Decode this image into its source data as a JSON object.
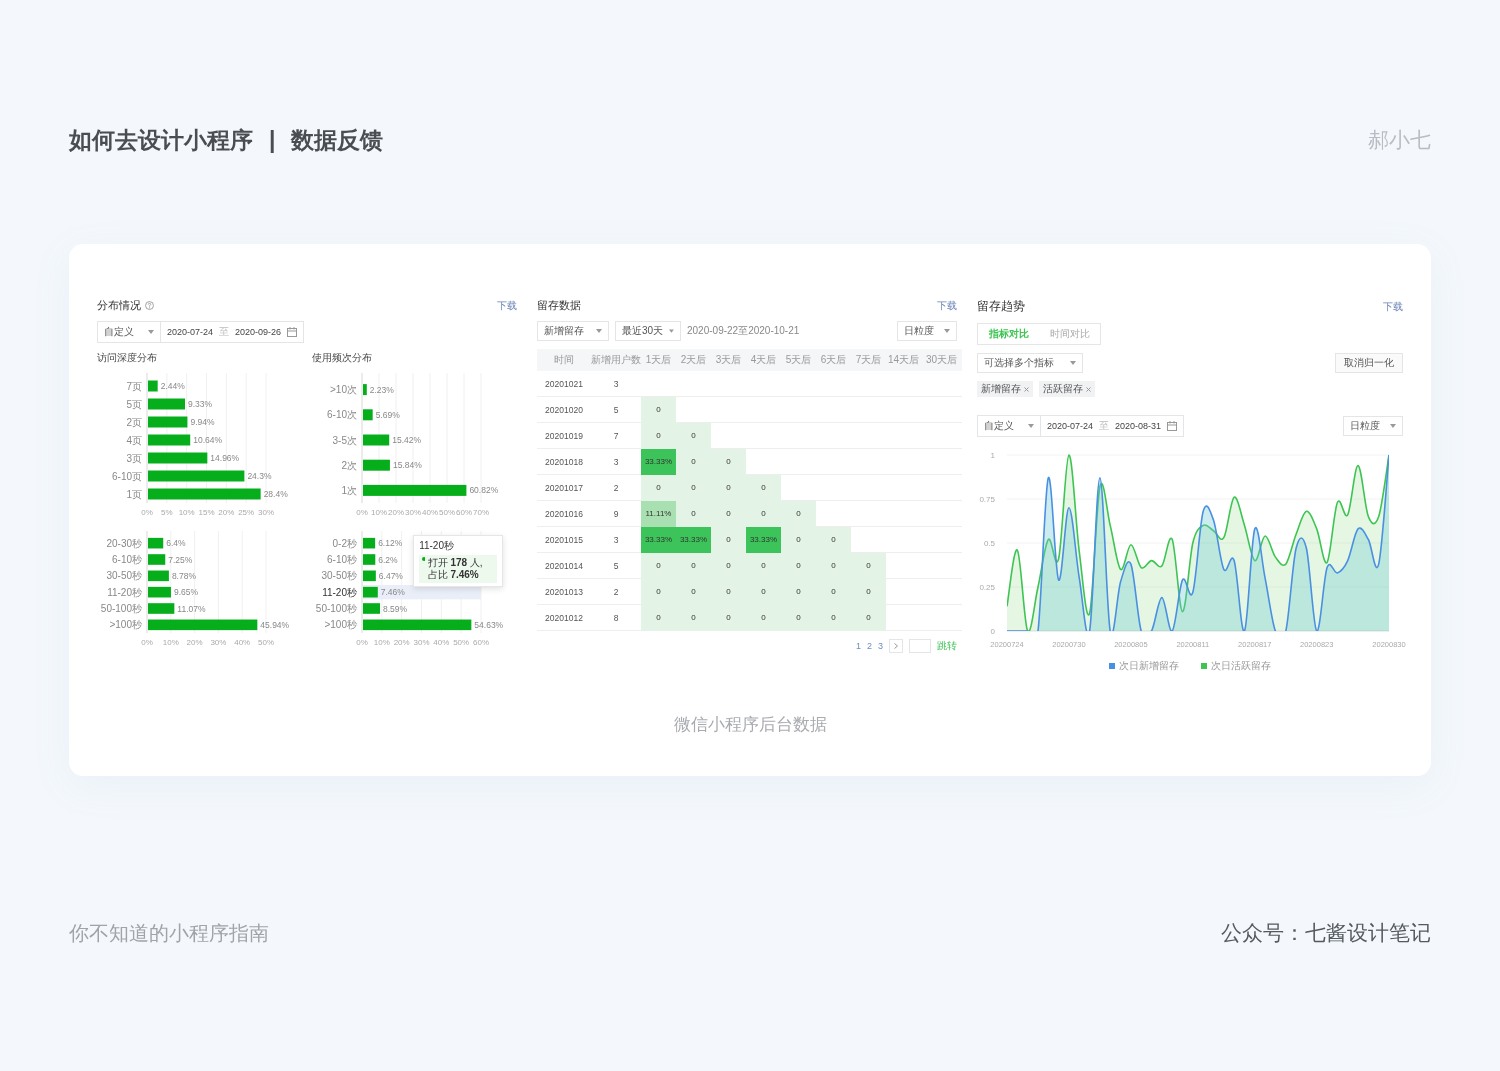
{
  "header": {
    "title": "如何去设计小程序",
    "separator": "|",
    "subtitle": "数据反馈",
    "author": "郝小七"
  },
  "distribution": {
    "title": "分布情况",
    "download": "下载",
    "date_range": {
      "preset": "自定义",
      "start": "2020-07-24",
      "separator": "至",
      "end": "2020-09-26"
    },
    "charts": [
      {
        "subtitle": "访问深度分布",
        "chart_data": {
          "type": "bar",
          "orientation": "horizontal",
          "grid": true,
          "categories": [
            "7页",
            "5页",
            "2页",
            "4页",
            "3页",
            "6-10页",
            "1页"
          ],
          "values": [
            2.44,
            9.33,
            9.94,
            10.64,
            14.96,
            24.3,
            28.4
          ],
          "value_labels": [
            "2.44%",
            "9.33%",
            "9.94%",
            "10.64%",
            "14.96%",
            "24.3%",
            "28.4%"
          ],
          "xlim": [
            0,
            30
          ],
          "xticks": [
            {
              "value": 0,
              "label": "0%"
            },
            {
              "value": 5,
              "label": "5%"
            },
            {
              "value": 10,
              "label": "10%"
            },
            {
              "value": 15,
              "label": "15%"
            },
            {
              "value": 20,
              "label": "20%"
            },
            {
              "value": 25,
              "label": "25%"
            },
            {
              "value": 30,
              "label": "30%"
            }
          ]
        }
      },
      {
        "subtitle": "使用频次分布",
        "chart_data": {
          "type": "bar",
          "orientation": "horizontal",
          "grid": true,
          "categories": [
            ">10次",
            "6-10次",
            "3-5次",
            "2次",
            "1次"
          ],
          "values": [
            2.23,
            5.69,
            15.42,
            15.84,
            60.82
          ],
          "value_labels": [
            "2.23%",
            "5.69%",
            "15.42%",
            "15.84%",
            "60.82%"
          ],
          "xlim": [
            0,
            70
          ],
          "xticks": [
            {
              "value": 0,
              "label": "0%"
            },
            {
              "value": 10,
              "label": "10%"
            },
            {
              "value": 20,
              "label": "20%"
            },
            {
              "value": 30,
              "label": "30%"
            },
            {
              "value": 40,
              "label": "40%"
            },
            {
              "value": 50,
              "label": "50%"
            },
            {
              "value": 60,
              "label": "60%"
            },
            {
              "value": 70,
              "label": "70%"
            }
          ]
        }
      },
      {
        "chart_data": {
          "type": "bar",
          "orientation": "horizontal",
          "grid": true,
          "categories": [
            "20-30秒",
            "6-10秒",
            "30-50秒",
            "11-20秒",
            "50-100秒",
            ">100秒"
          ],
          "values": [
            6.4,
            7.25,
            8.78,
            9.65,
            11.07,
            45.94
          ],
          "value_labels": [
            "6.4%",
            "7.25%",
            "8.78%",
            "9.65%",
            "11.07%",
            "45.94%"
          ],
          "xlim": [
            0,
            50
          ],
          "xticks": [
            {
              "value": 0,
              "label": "0%"
            },
            {
              "value": 10,
              "label": "10%"
            },
            {
              "value": 20,
              "label": "20%"
            },
            {
              "value": 30,
              "label": "30%"
            },
            {
              "value": 40,
              "label": "40%"
            },
            {
              "value": 50,
              "label": "50%"
            }
          ]
        }
      },
      {
        "chart_data": {
          "type": "bar",
          "orientation": "horizontal",
          "grid": true,
          "categories": [
            "0-2秒",
            "6-10秒",
            "30-50秒",
            "11-20秒",
            "50-100秒",
            ">100秒"
          ],
          "values": [
            6.12,
            6.2,
            6.47,
            7.46,
            8.59,
            54.63
          ],
          "value_labels": [
            "6.12%",
            "6.2%",
            "6.47%",
            "7.46%",
            "8.59%",
            "54.63%"
          ],
          "xlim": [
            0,
            60
          ],
          "xticks": [
            {
              "value": 0,
              "label": "0%"
            },
            {
              "value": 10,
              "label": "10%"
            },
            {
              "value": 20,
              "label": "20%"
            },
            {
              "value": 30,
              "label": "30%"
            },
            {
              "value": 40,
              "label": "40%"
            },
            {
              "value": 50,
              "label": "50%"
            },
            {
              "value": 60,
              "label": "60%"
            }
          ]
        },
        "highlighted": [
          false,
          false,
          false,
          true,
          false,
          false
        ],
        "tooltip": {
          "title": "11-20秒",
          "text": "打开 **178** 人, 占比 **7.46%**"
        }
      }
    ]
  },
  "retention_table": {
    "title": "留存数据",
    "download": "下载",
    "filters": [
      "新增留存",
      "最近30天"
    ],
    "range_text": "2020-09-22至2020-10-21",
    "granularity": "日粒度",
    "columns": [
      "时间",
      "新增用户数",
      "1天后",
      "2天后",
      "3天后",
      "4天后",
      "5天后",
      "6天后",
      "7天后",
      "14天后",
      "30天后"
    ],
    "rows": [
      {
        "date": "20201021",
        "count": "3"
      },
      {
        "date": "20201020",
        "count": "5",
        "cells": [
          {
            "text": "0",
            "color": "#e3f3e5"
          }
        ]
      },
      {
        "date": "20201019",
        "count": "7",
        "cells": [
          {
            "text": "0",
            "color": "#e3f3e5"
          },
          {
            "text": "0",
            "color": "#e3f3e5"
          }
        ]
      },
      {
        "date": "20201018",
        "count": "3",
        "cells": [
          {
            "text": "33.33%",
            "color": "#3cc45a"
          },
          {
            "text": "0",
            "color": "#e3f3e5"
          },
          {
            "text": "0",
            "color": "#e3f3e5"
          }
        ]
      },
      {
        "date": "20201017",
        "count": "2",
        "cells": [
          {
            "text": "0",
            "color": "#e3f3e5"
          },
          {
            "text": "0",
            "color": "#e3f3e5"
          },
          {
            "text": "0",
            "color": "#e3f3e5"
          },
          {
            "text": "0",
            "color": "#e3f3e5"
          }
        ]
      },
      {
        "date": "20201016",
        "count": "9",
        "cells": [
          {
            "text": "11.11%",
            "color": "#a9e0b2"
          },
          {
            "text": "0",
            "color": "#e3f3e5"
          },
          {
            "text": "0",
            "color": "#e3f3e5"
          },
          {
            "text": "0",
            "color": "#e3f3e5"
          },
          {
            "text": "0",
            "color": "#e3f3e5"
          }
        ]
      },
      {
        "date": "20201015",
        "count": "3",
        "cells": [
          {
            "text": "33.33%",
            "color": "#3cc45a"
          },
          {
            "text": "33.33%",
            "color": "#3cc45a"
          },
          {
            "text": "0",
            "color": "#e3f3e5"
          },
          {
            "text": "33.33%",
            "color": "#3cc45a"
          },
          {
            "text": "0",
            "color": "#e3f3e5"
          },
          {
            "text": "0",
            "color": "#e3f3e5"
          }
        ]
      },
      {
        "date": "20201014",
        "count": "5",
        "cells": [
          {
            "text": "0",
            "color": "#e3f3e5"
          },
          {
            "text": "0",
            "color": "#e3f3e5"
          },
          {
            "text": "0",
            "color": "#e3f3e5"
          },
          {
            "text": "0",
            "color": "#e3f3e5"
          },
          {
            "text": "0",
            "color": "#e3f3e5"
          },
          {
            "text": "0",
            "color": "#e3f3e5"
          },
          {
            "text": "0",
            "color": "#e3f3e5"
          }
        ]
      },
      {
        "date": "20201013",
        "count": "2",
        "cells": [
          {
            "text": "0",
            "color": "#e3f3e5"
          },
          {
            "text": "0",
            "color": "#e3f3e5"
          },
          {
            "text": "0",
            "color": "#e3f3e5"
          },
          {
            "text": "0",
            "color": "#e3f3e5"
          },
          {
            "text": "0",
            "color": "#e3f3e5"
          },
          {
            "text": "0",
            "color": "#e3f3e5"
          },
          {
            "text": "0",
            "color": "#e3f3e5"
          }
        ]
      },
      {
        "date": "20201012",
        "count": "8",
        "cells": [
          {
            "text": "0",
            "color": "#e3f3e5"
          },
          {
            "text": "0",
            "color": "#e3f3e5"
          },
          {
            "text": "0",
            "color": "#e3f3e5"
          },
          {
            "text": "0",
            "color": "#e3f3e5"
          },
          {
            "text": "0",
            "color": "#e3f3e5"
          },
          {
            "text": "0",
            "color": "#e3f3e5"
          },
          {
            "text": "0",
            "color": "#e3f3e5"
          }
        ]
      }
    ],
    "pagination": {
      "pages": [
        "1",
        "2",
        "3"
      ],
      "jump": "跳转"
    }
  },
  "retention_trend": {
    "title": "留存趋势",
    "download": "下载",
    "tabs": [
      {
        "label": "指标对比",
        "selected": true
      },
      {
        "label": "时间对比",
        "selected": false
      }
    ],
    "metric_select": {
      "placeholder": "可选择多个指标"
    },
    "tags": [
      "新增留存",
      "活跃留存"
    ],
    "normalize_button": "取消归一化",
    "date_range": {
      "preset": "自定义",
      "start": "2020-07-24",
      "separator": "至",
      "end": "2020-08-31"
    },
    "granularity": "日粒度",
    "chart_data": {
      "type": "area",
      "grid": true,
      "legend": "bottom",
      "categories": [
        "20200724",
        null,
        null,
        null,
        null,
        null,
        "20200730",
        null,
        null,
        null,
        null,
        null,
        "20200805",
        null,
        null,
        null,
        null,
        null,
        "20200811",
        null,
        null,
        null,
        null,
        null,
        "20200817",
        null,
        null,
        null,
        null,
        null,
        "20200823",
        null,
        null,
        null,
        null,
        null,
        null,
        "20200830"
      ],
      "series": [
        {
          "name": "次日新增留存",
          "color": "#4a90e2",
          "values": [
            0,
            0,
            0,
            0,
            0.87,
            0.29,
            0.7,
            0.3,
            0,
            0.87,
            0,
            0.28,
            0.38,
            0,
            0,
            0.19,
            0,
            0.29,
            0.22,
            0.68,
            0.63,
            0.35,
            0.4,
            0,
            0.58,
            0.3,
            0,
            0,
            0.47,
            0.47,
            0,
            0.36,
            0.33,
            0.4,
            0.58,
            0.52,
            0.38,
            1
          ]
        },
        {
          "name": "次日活跃留存",
          "color": "#3ec453",
          "values": [
            0.14,
            0.46,
            0,
            0.25,
            0.52,
            0.41,
            1,
            0.45,
            0.1,
            0.82,
            0.6,
            0.35,
            0.49,
            0.36,
            0.4,
            0.37,
            0.52,
            0.11,
            0.5,
            0.6,
            0.57,
            0.53,
            0.76,
            0.6,
            0.4,
            0.54,
            0.42,
            0.38,
            0.55,
            0.68,
            0.58,
            0.39,
            0.73,
            0.66,
            0.94,
            0.65,
            0.65,
            1
          ]
        }
      ],
      "ylim": [
        0,
        1
      ],
      "yticks": [
        {
          "value": 0,
          "label": "0"
        },
        {
          "value": 0.25,
          "label": "0.25"
        },
        {
          "value": 0.5,
          "label": "0.5"
        },
        {
          "value": 0.75,
          "label": "0.75"
        },
        {
          "value": 1,
          "label": "1"
        }
      ]
    }
  },
  "caption": "微信小程序后台数据",
  "footer": {
    "left": "你不知道的小程序指南",
    "right": "公众号：七酱设计笔记"
  }
}
